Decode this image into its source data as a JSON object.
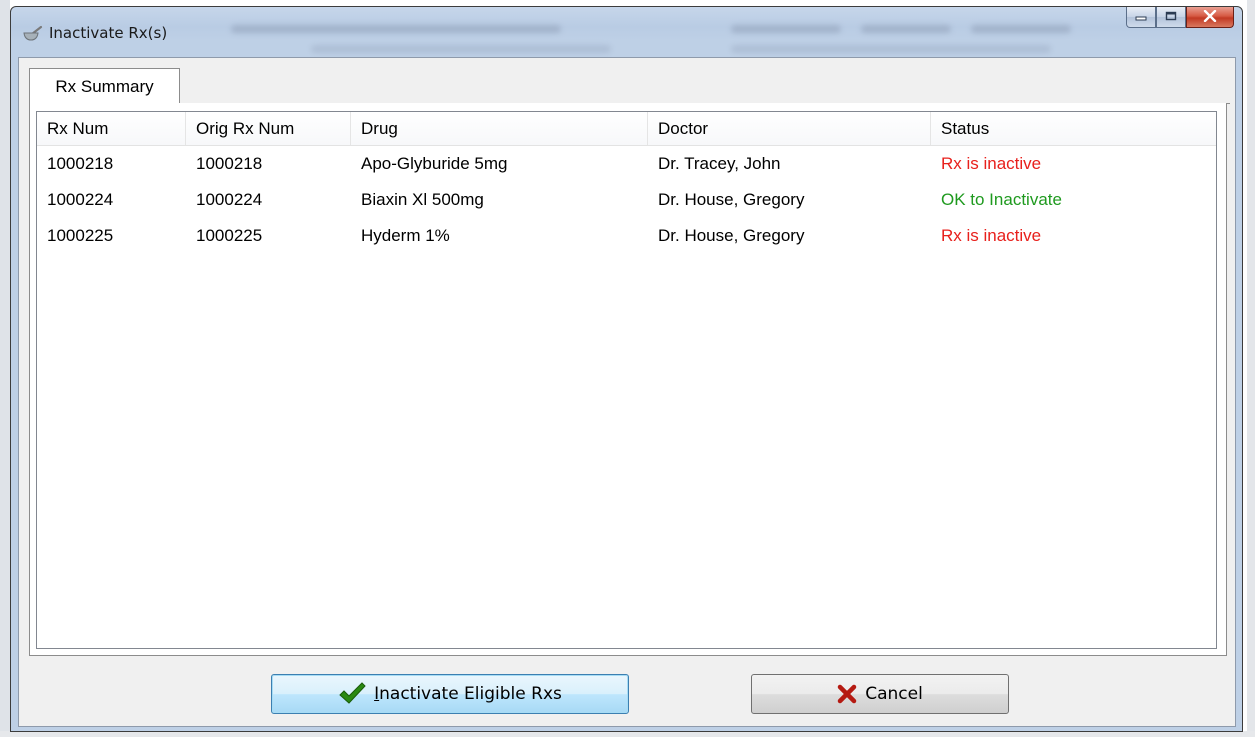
{
  "window": {
    "title": "Inactivate Rx(s)"
  },
  "tabs": [
    {
      "label": "Rx Summary",
      "selected": true
    }
  ],
  "table": {
    "columns": [
      "Rx Num",
      "Orig Rx Num",
      "Drug",
      "Doctor",
      "Status"
    ],
    "rows": [
      {
        "rx_num": "1000218",
        "orig_rx_num": "1000218",
        "drug": "Apo-Glyburide 5mg",
        "doctor": "Dr. Tracey, John",
        "status": "Rx is inactive",
        "status_color": "#e8201c"
      },
      {
        "rx_num": "1000224",
        "orig_rx_num": "1000224",
        "drug": "Biaxin Xl 500mg",
        "doctor": "Dr. House, Gregory",
        "status": "OK to Inactivate",
        "status_color": "#1f9a1f"
      },
      {
        "rx_num": "1000225",
        "orig_rx_num": "1000225",
        "drug": "Hyderm 1%",
        "doctor": "Dr. House, Gregory",
        "status": "Rx is inactive",
        "status_color": "#e8201c"
      }
    ]
  },
  "buttons": {
    "inactivate": {
      "label": "Inactivate Eligible Rxs",
      "icon": "check-icon",
      "mnemonic": "I"
    },
    "cancel": {
      "label": "Cancel",
      "icon": "x-icon"
    }
  },
  "colors": {
    "title_bar": "#bed0e6",
    "status_inactive": "#e8201c",
    "status_ok": "#1f9a1f",
    "check_icon": "#2a8a12",
    "cancel_icon": "#b51a12"
  }
}
